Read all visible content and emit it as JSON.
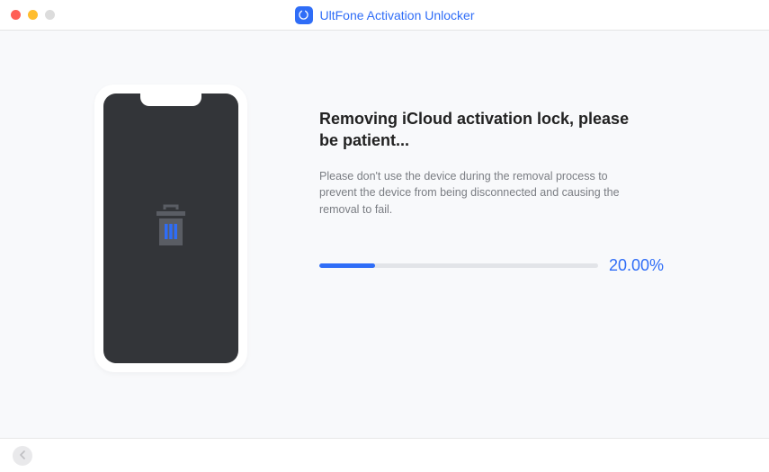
{
  "app": {
    "title": "UltFone Activation Unlocker"
  },
  "main": {
    "headline": "Removing iCloud activation lock, please be patient...",
    "description": "Please don't use the device during the removal process to prevent the device from being disconnected and causing the removal to fail.",
    "progress_text": "20.00%",
    "progress_value": "20"
  },
  "colors": {
    "accent": "#2f6df7"
  }
}
